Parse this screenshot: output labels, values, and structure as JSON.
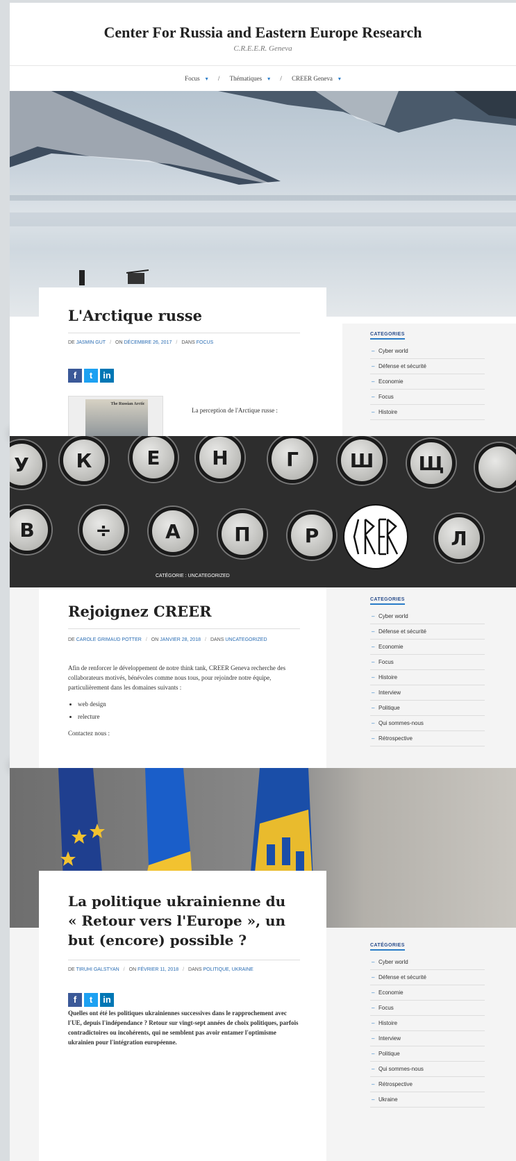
{
  "site": {
    "title": "Center For Russia and Eastern Europe Research",
    "subtitle": "C.R.E.E.R. Geneva",
    "nav": [
      {
        "label": "Focus",
        "caret": "▾"
      },
      {
        "label": "Thématiques",
        "caret": "▾"
      },
      {
        "label": "CREER Geneva",
        "caret": "▾"
      }
    ],
    "nav_sep": "/"
  },
  "social": {
    "facebook": "f",
    "twitter": "t",
    "linkedin": "in"
  },
  "article1": {
    "title": "L'Arctique russe",
    "by": "DE",
    "author": "JASMIN GUT",
    "on": "ON",
    "date": "DÉCEMBRE 26, 2017",
    "in": "DANS",
    "category": "FOCUS",
    "thumb_title": "The Russian Arctic",
    "excerpt": "La perception de l'Arctique russe :"
  },
  "sidebar": {
    "title": "CATEGORIES",
    "title_accent": "CATÉGORIES",
    "items1": [
      "Cyber world",
      "Défense et sécurité",
      "Economie",
      "Focus",
      "Histoire"
    ],
    "items2": [
      "Cyber world",
      "Défense et sécurité",
      "Economie",
      "Focus",
      "Histoire",
      "Interview",
      "Politique",
      "Qui sommes-nous",
      "Rétrospective"
    ],
    "items3": [
      "Cyber world",
      "Défense et sécurité",
      "Economie",
      "Focus",
      "Histoire",
      "Interview",
      "Politique",
      "Qui sommes-nous",
      "Rétrospective",
      "Ukraine"
    ]
  },
  "typewriter": {
    "row1": [
      "У",
      "К",
      "Е",
      "Н",
      "Г",
      "Ш",
      "Щ"
    ],
    "row2": [
      "В",
      "÷",
      "А",
      "П",
      "Р",
      "Л"
    ],
    "logo": "CREER",
    "category_label": "CATÉGORIE : UNCATEGORIZED"
  },
  "article2": {
    "title": "Rejoignez CREER",
    "by": "DE",
    "author": "CAROLE GRIMAUD POTTER",
    "on": "ON",
    "date": "JANVIER 28, 2018",
    "in": "DANS",
    "category": "UNCATEGORIZED",
    "paragraph": "Afin de renforcer le développement de notre think tank, CREER Geneva recherche des collaborateurs motivés, bénévoles comme nous tous, pour rejoindre notre équipe, particulièrement dans les domaines suivants :",
    "list": [
      "web design",
      "relecture"
    ],
    "contact": "Contactez nous :"
  },
  "article3": {
    "title": "La politique ukrainienne du « Retour vers l'Europe », un but (encore) possible ?",
    "by": "DE",
    "author": "TIRUHI GALSTYAN",
    "on": "ON",
    "date": "FÉVRIER 11, 2018",
    "in": "DANS",
    "category": "POLITIQUE, UKRAINE",
    "excerpt": "Quelles ont été les politiques ukrainiennes successives dans le rapprochement avec l'UE, depuis l'indépendance ? Retour sur vingt-sept années de choix politiques, parfois contradictoires ou incohérents, qui ne semblent pas avoir entamer l'optimisme ukrainien pour l'intégration européenne."
  },
  "colors": {
    "accent": "#2a7cc8",
    "link": "#2a6db3",
    "eu_blue": "#1f3f8f",
    "ukr_yellow": "#f2c230"
  }
}
